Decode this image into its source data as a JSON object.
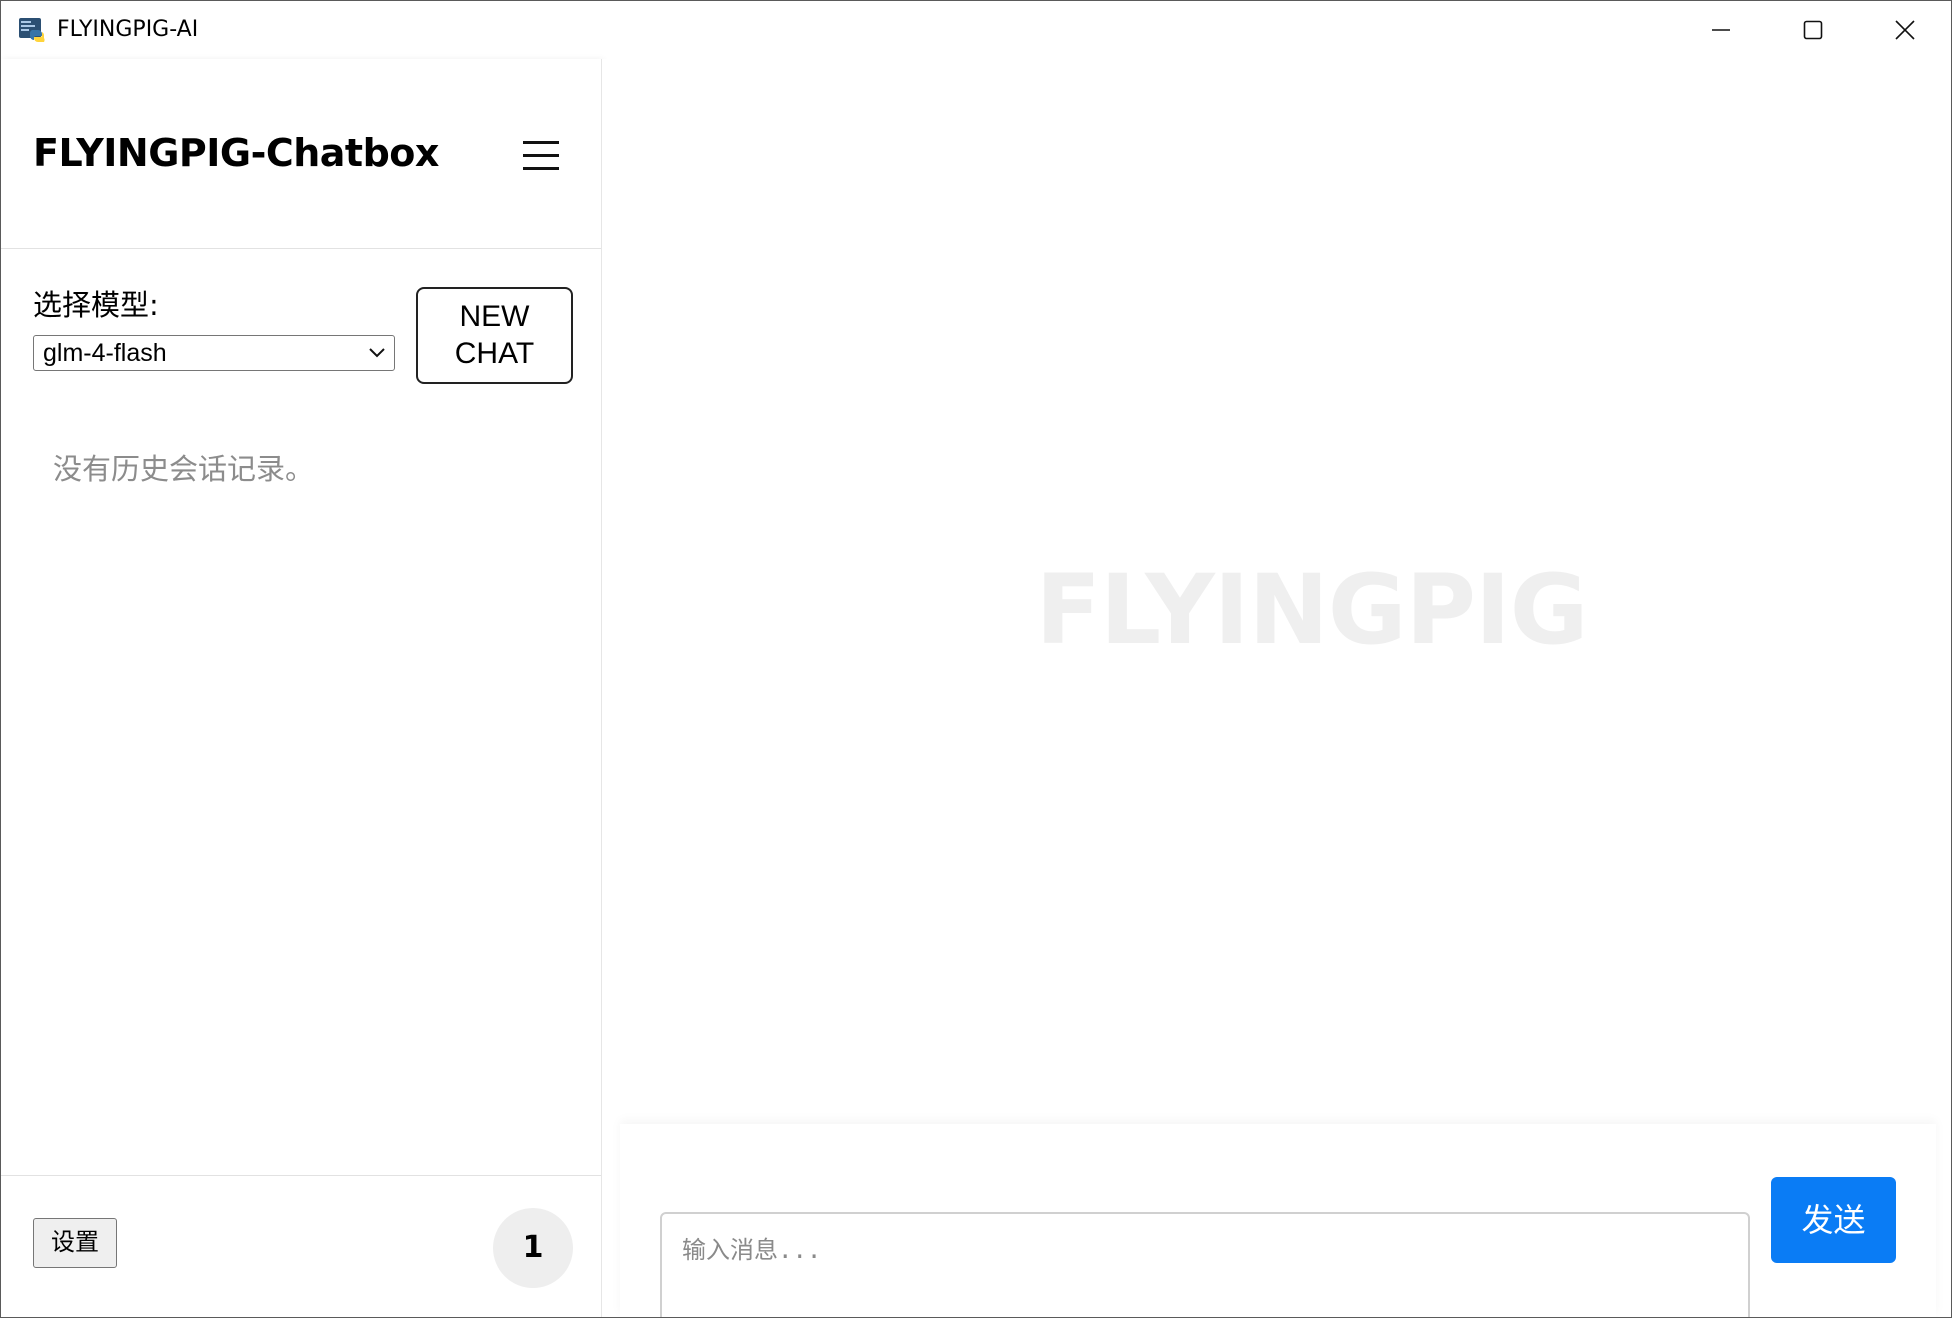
{
  "window": {
    "title": "FLYINGPIG-AI",
    "icon": "python-icon",
    "controls": {
      "minimize": "minimize-icon",
      "maximize": "maximize-icon",
      "close": "close-icon"
    }
  },
  "sidebar": {
    "app_name": "FLYINGPIG-Chatbox",
    "menu_icon": "hamburger-menu-icon",
    "model_label": "选择模型:",
    "model_selected": "glm-4-flash",
    "new_chat_line1": "NEW",
    "new_chat_line2": "CHAT",
    "history_empty": "没有历史会话记录。",
    "settings_label": "设置",
    "counter": "1"
  },
  "main": {
    "watermark": "FLYINGPIG",
    "input_placeholder": "输入消息...",
    "send_label": "发送"
  },
  "colors": {
    "accent": "#0a7cf5",
    "watermark": "#efefef",
    "muted_text": "#8c8c8c"
  }
}
